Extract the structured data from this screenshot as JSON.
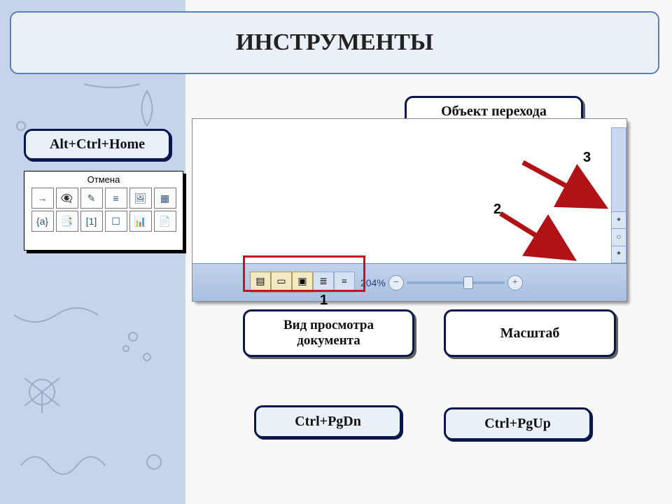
{
  "title": "ИНСТРУМЕНТЫ",
  "callouts": {
    "shortcut_home": "Alt+Ctrl+Home",
    "nav_object": "Объект перехода",
    "view_mode": "Вид просмотра документа",
    "zoom": "Масштаб",
    "pgdn": "Ctrl+PgDn",
    "pgup": "Ctrl+PgUp"
  },
  "dialog": {
    "title": "Отмена",
    "cells_row1": [
      "→",
      "👁‍🗨",
      "✎",
      "≡",
      "🖼",
      "▦"
    ],
    "cells_row2": [
      "{a}",
      "📑",
      "[1]",
      "☐",
      "📊",
      "📄"
    ]
  },
  "status": {
    "zoom_pct": "204%"
  },
  "markers": {
    "one": "1",
    "two": "2",
    "three": "3"
  }
}
